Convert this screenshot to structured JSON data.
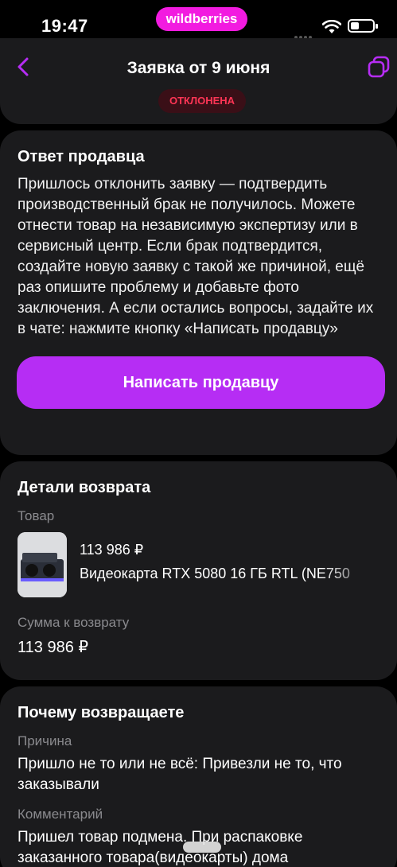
{
  "status_bar": {
    "time": "19:47",
    "app_badge": "wildberries"
  },
  "header": {
    "title": "Заявка от 9 июня",
    "status": "ОТКЛОНЕНА"
  },
  "colors": {
    "accent": "#b62df4",
    "brand": "#f21be0",
    "status_rejected": "#ff3555",
    "card_bg": "#1b1b1d"
  },
  "icons": {
    "back": "chevron-left-icon",
    "copy": "copy-icon",
    "wifi": "wifi-icon",
    "battery": "battery-icon"
  },
  "seller_reply": {
    "heading": "Ответ продавца",
    "text": "Пришлось отклонить заявку — подтвердить производственный брак не получилось. Можете отнести товар на независимую экспертизу или в сервисный центр. Если брак подтвердится, создайте новую заявку с такой же причиной, ещё раз опишите проблему и добавьте фото заключения. А если остались вопросы, задайте их в чате: нажмите кнопку «Написать продавцу»",
    "button": "Написать продавцу"
  },
  "return_details": {
    "heading": "Детали возврата",
    "product_label": "Товар",
    "product_price": "113 986 ₽",
    "product_name": "Видеокарта RTX 5080 16 ГБ RTL (NE750",
    "refund_label": "Сумма к возврату",
    "refund_amount": "113 986 ₽"
  },
  "reason": {
    "heading": "Почему возвращаете",
    "reason_label": "Причина",
    "reason_text": "Пришло не то или не всё: Привезли не то, что заказывали",
    "comment_label": "Комментарий",
    "comment_text": "Пришел товар подмена. При распаковке заказанного товара(видеокарты) дома"
  }
}
